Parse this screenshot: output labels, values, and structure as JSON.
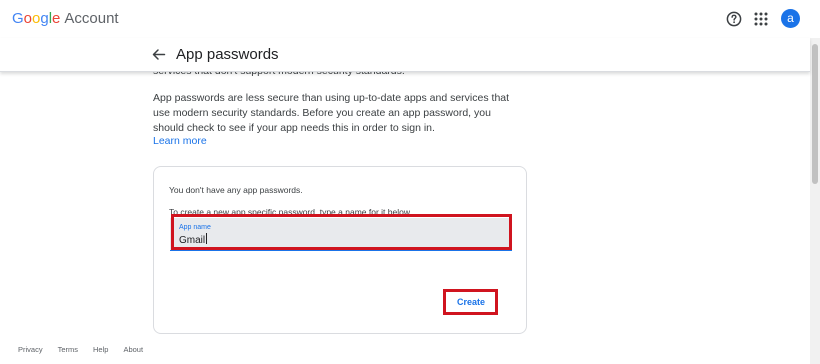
{
  "brand": {
    "letters": [
      "G",
      "o",
      "o",
      "g",
      "l",
      "e"
    ],
    "product": "Account"
  },
  "header": {
    "help_icon": "help-circle-icon",
    "apps_icon": "apps-grid-icon",
    "avatar_initial": "a"
  },
  "page": {
    "back_icon": "arrow-left-icon",
    "title": "App passwords"
  },
  "intro": {
    "partial": "services that don't support modern security standards.",
    "paragraph": "App passwords are less secure than using up-to-date apps and services that use modern security standards. Before you create an app password, you should check to see if your app needs this in order to sign in.",
    "learn_more": "Learn more"
  },
  "card": {
    "empty_message": "You don't have any app passwords.",
    "create_hint": "To create a new app specific password, type a name for it below...",
    "app_name_label": "App name",
    "app_name_value": "Gmail",
    "create_label": "Create"
  },
  "footer": {
    "links": [
      "Privacy",
      "Terms",
      "Help",
      "About"
    ]
  },
  "colors": {
    "accent": "#1a73e8",
    "highlight": "#d0141f",
    "field_bg": "#e8eaed"
  }
}
